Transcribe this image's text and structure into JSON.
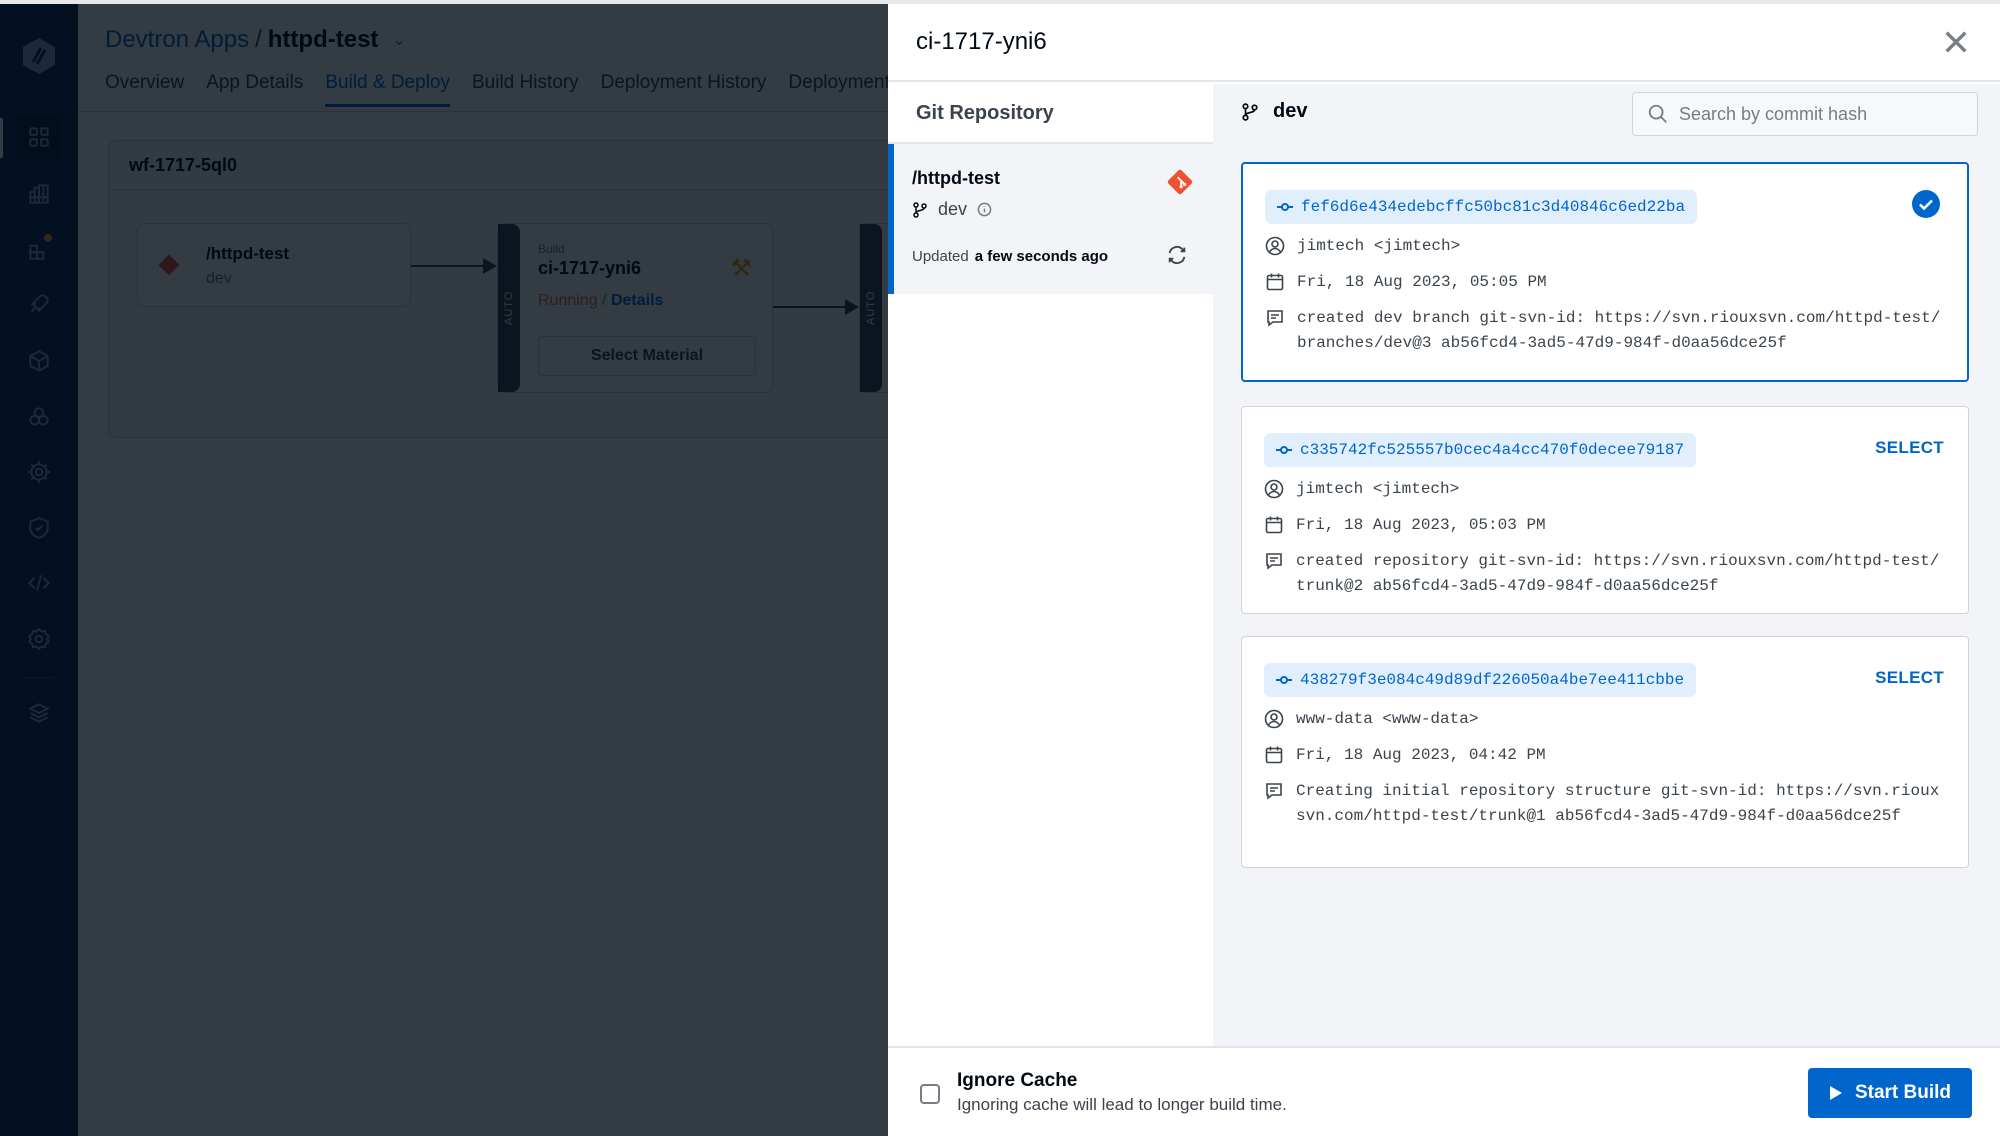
{
  "background_app": {
    "breadcrumb": {
      "parent": "Devtron Apps",
      "separator": "/",
      "app_name": "httpd-test"
    },
    "tabs": [
      {
        "label": "Overview",
        "active": false
      },
      {
        "label": "App Details",
        "active": false
      },
      {
        "label": "Build & Deploy",
        "active": true
      },
      {
        "label": "Build History",
        "active": false
      },
      {
        "label": "Deployment History",
        "active": false
      },
      {
        "label": "Deployment Metrics",
        "active": false
      }
    ],
    "nav_icons": [
      "devtron-logo-icon",
      "applications-icon",
      "charts-icon",
      "app-groups-icon",
      "deploy-icon",
      "resource-browser-icon",
      "bulk-edit-icon",
      "global-config-icon",
      "security-icon",
      "code-icon",
      "settings-icon",
      "stack-manager-icon"
    ],
    "workflow": {
      "name": "wf-1717-5ql0",
      "git_node": {
        "name": "/httpd-test",
        "branch": "dev"
      },
      "build_node": {
        "type_label": "Build",
        "name": "ci-1717-yni6",
        "trigger": "AUTO",
        "status": "Running",
        "status_sep": "/",
        "details_label": "Details",
        "select_material_label": "Select Material"
      },
      "cd_node": {
        "trigger": "AUTO"
      }
    }
  },
  "modal": {
    "title": "ci-1717-yni6",
    "left_panel": {
      "heading": "Git Repository",
      "repo": {
        "name": "/httpd-test",
        "branch": "dev",
        "updated_label": "Updated",
        "updated_value": "a few seconds ago"
      }
    },
    "right_panel": {
      "branch": "dev",
      "search": {
        "placeholder": "Search by commit hash",
        "value": ""
      },
      "select_label": "SELECT",
      "commits": [
        {
          "hash": "fef6d6e434edebcffc50bc81c3d40846c6ed22ba",
          "author": "jimtech <jimtech>",
          "date": "Fri, 18 Aug 2023, 05:05 PM",
          "message": "created dev branch git-svn-id: https://svn.riouxsvn.com/httpd-test/branches/dev@3 ab56fcd4-3ad5-47d9-984f-d0aa56dce25f",
          "selected": true
        },
        {
          "hash": "c335742fc525557b0cec4a4cc470f0decee79187",
          "author": "jimtech <jimtech>",
          "date": "Fri, 18 Aug 2023, 05:03 PM",
          "message": "created repository git-svn-id: https://svn.riouxsvn.com/httpd-test/trunk@2 ab56fcd4-3ad5-47d9-984f-d0aa56dce25f",
          "selected": false
        },
        {
          "hash": "438279f3e084c49d89df226050a4be7ee411cbbe",
          "author": "www-data <www-data>",
          "date": "Fri, 18 Aug 2023, 04:42 PM",
          "message": "Creating initial repository structure git-svn-id: https://svn.riouxsvn.com/httpd-test/trunk@1 ab56fcd4-3ad5-47d9-984f-d0aa56dce25f",
          "selected": false
        }
      ]
    },
    "footer": {
      "ignore_cache": {
        "checked": false,
        "title": "Ignore Cache",
        "description": "Ignoring cache will lead to longer build time."
      },
      "start_build_label": "Start Build"
    },
    "colors": {
      "accent": "#0066cc",
      "git_orange": "#f05133",
      "panel_bg": "#f2f4f7",
      "hash_bg": "#e1effd"
    }
  }
}
